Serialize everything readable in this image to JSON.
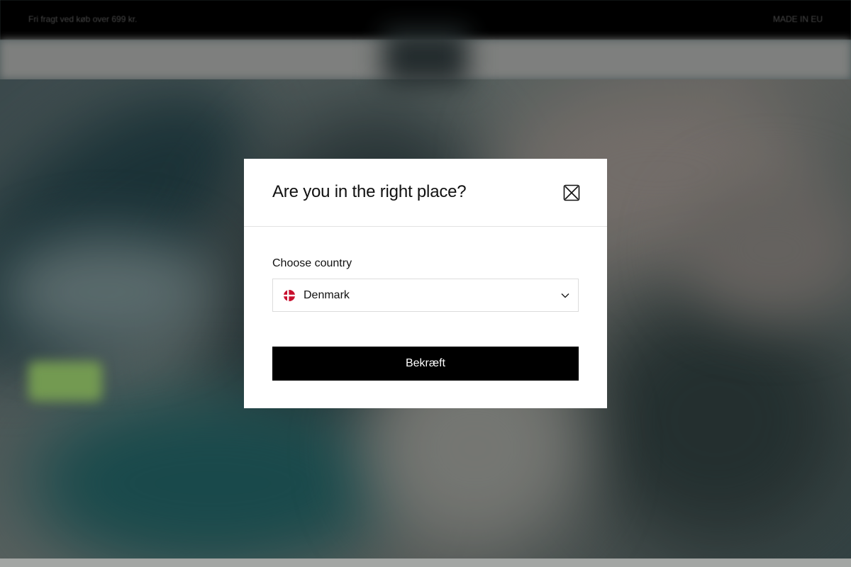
{
  "background": {
    "announcement_left": "Fri fragt ved køb over 699 kr.",
    "announcement_right": "MADE IN EU"
  },
  "modal": {
    "title": "Are you in the right place?",
    "close_icon": "close-icon",
    "country_label": "Choose country",
    "selected_country": "Denmark",
    "selected_country_flag": "denmark-flag-icon",
    "confirm_label": "Bekræft"
  },
  "colors": {
    "confirm_button_bg": "#000000",
    "flag_red": "#c8102e"
  }
}
